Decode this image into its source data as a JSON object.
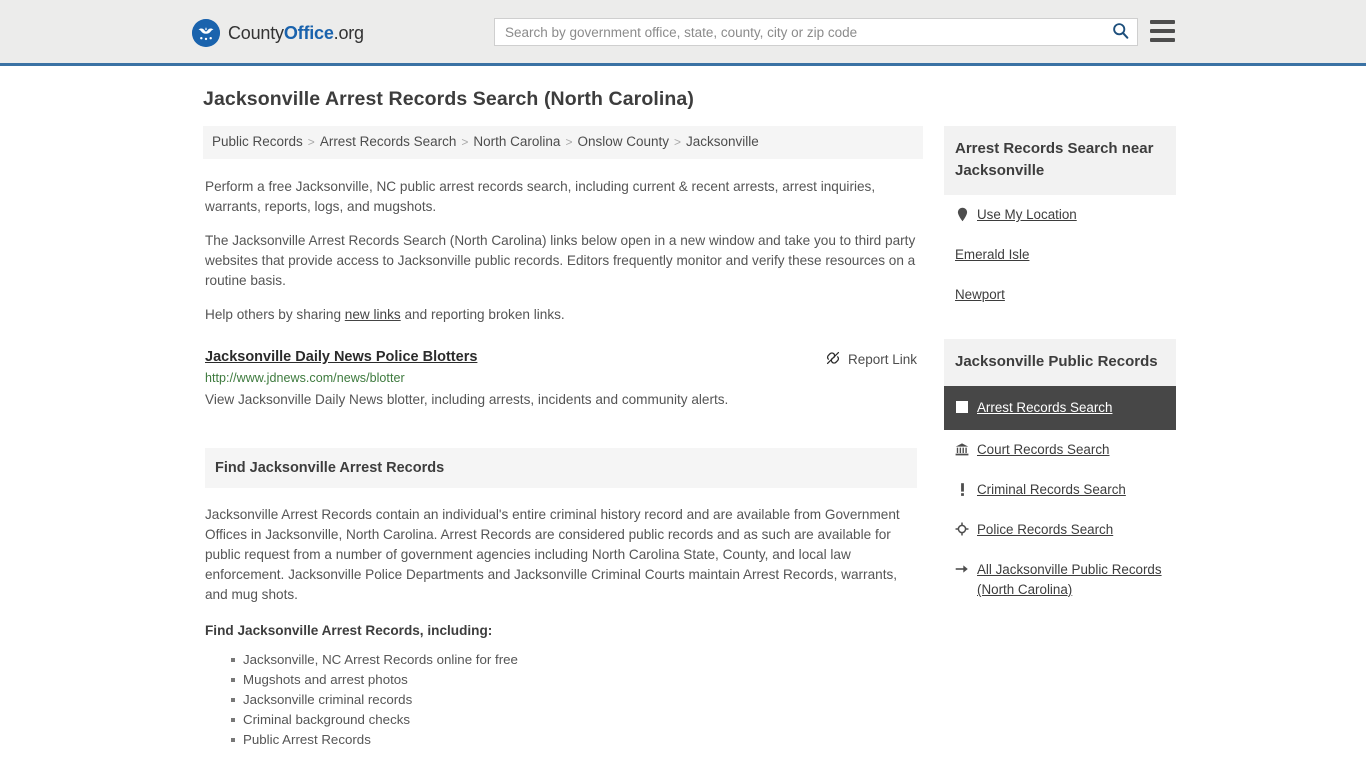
{
  "header": {
    "brand": {
      "part1": "County",
      "part2": "Office",
      "part3": ".org",
      "icon": "eagle-seal-icon"
    },
    "search": {
      "value": "",
      "placeholder": "Search by government office, state, county, city or zip code",
      "icon": "search-icon"
    },
    "menu": {
      "icon": "hamburger-menu-icon",
      "label": "Menu"
    },
    "accent_color": "#3b72a4",
    "background_color": "#ececeb"
  },
  "page": {
    "title": "Jacksonville Arrest Records Search (North Carolina)"
  },
  "breadcrumb": {
    "separator": ">",
    "items": [
      {
        "label": "Public Records"
      },
      {
        "label": "Arrest Records Search"
      },
      {
        "label": "North Carolina"
      },
      {
        "label": "Onslow County"
      },
      {
        "label": "Jacksonville"
      }
    ]
  },
  "intro": {
    "p1": "Perform a free Jacksonville, NC public arrest records search, including current & recent arrests, arrest inquiries, warrants, reports, logs, and mugshots.",
    "p2": "The Jacksonville Arrest Records Search (North Carolina) links below open in a new window and take you to third party websites that provide access to Jacksonville public records. Editors frequently monitor and verify these resources on a routine basis.",
    "p3_before": "Help others by sharing ",
    "p3_link": "new links",
    "p3_after": " and reporting broken links."
  },
  "result": {
    "title": "Jacksonville Daily News Police Blotters",
    "url": "http://www.jdnews.com/news/blotter",
    "description": "View Jacksonville Daily News blotter, including arrests, incidents and community alerts.",
    "report_label": "Report Link",
    "report_icon": "broken-link-icon",
    "url_color": "#3d7a3d"
  },
  "section": {
    "heading": "Find Jacksonville Arrest Records",
    "body": "Jacksonville Arrest Records contain an individual's entire criminal history record and are available from Government Offices in Jacksonville, North Carolina. Arrest Records are considered public records and as such are available for public request from a number of government agencies including North Carolina State, County, and local law enforcement. Jacksonville Police Departments and Jacksonville Criminal Courts maintain Arrest Records, warrants, and mug shots.",
    "sub_heading": "Find Jacksonville Arrest Records, including:",
    "bullets": [
      "Jacksonville, NC Arrest Records online for free",
      "Mugshots and arrest photos",
      "Jacksonville criminal records",
      "Criminal background checks",
      "Public Arrest Records"
    ]
  },
  "sidebar": {
    "near_card": {
      "heading": "Arrest Records Search near Jacksonville",
      "items": [
        {
          "label": "Use My Location",
          "icon": "map-pin-icon"
        },
        {
          "label": "Emerald Isle",
          "icon": ""
        },
        {
          "label": "Newport",
          "icon": ""
        }
      ]
    },
    "records_card": {
      "heading": "Jacksonville Public Records",
      "active_background": "#474747",
      "items": [
        {
          "label": "Arrest Records Search",
          "icon": "handcuffs-square-icon",
          "active": true
        },
        {
          "label": "Court Records Search",
          "icon": "courthouse-icon",
          "active": false
        },
        {
          "label": "Criminal Records Search",
          "icon": "exclamation-icon",
          "active": false
        },
        {
          "label": "Police Records Search",
          "icon": "police-badge-icon",
          "active": false
        },
        {
          "label": "All Jacksonville Public Records (North Carolina)",
          "icon": "arrow-right-icon",
          "active": false
        }
      ]
    }
  }
}
